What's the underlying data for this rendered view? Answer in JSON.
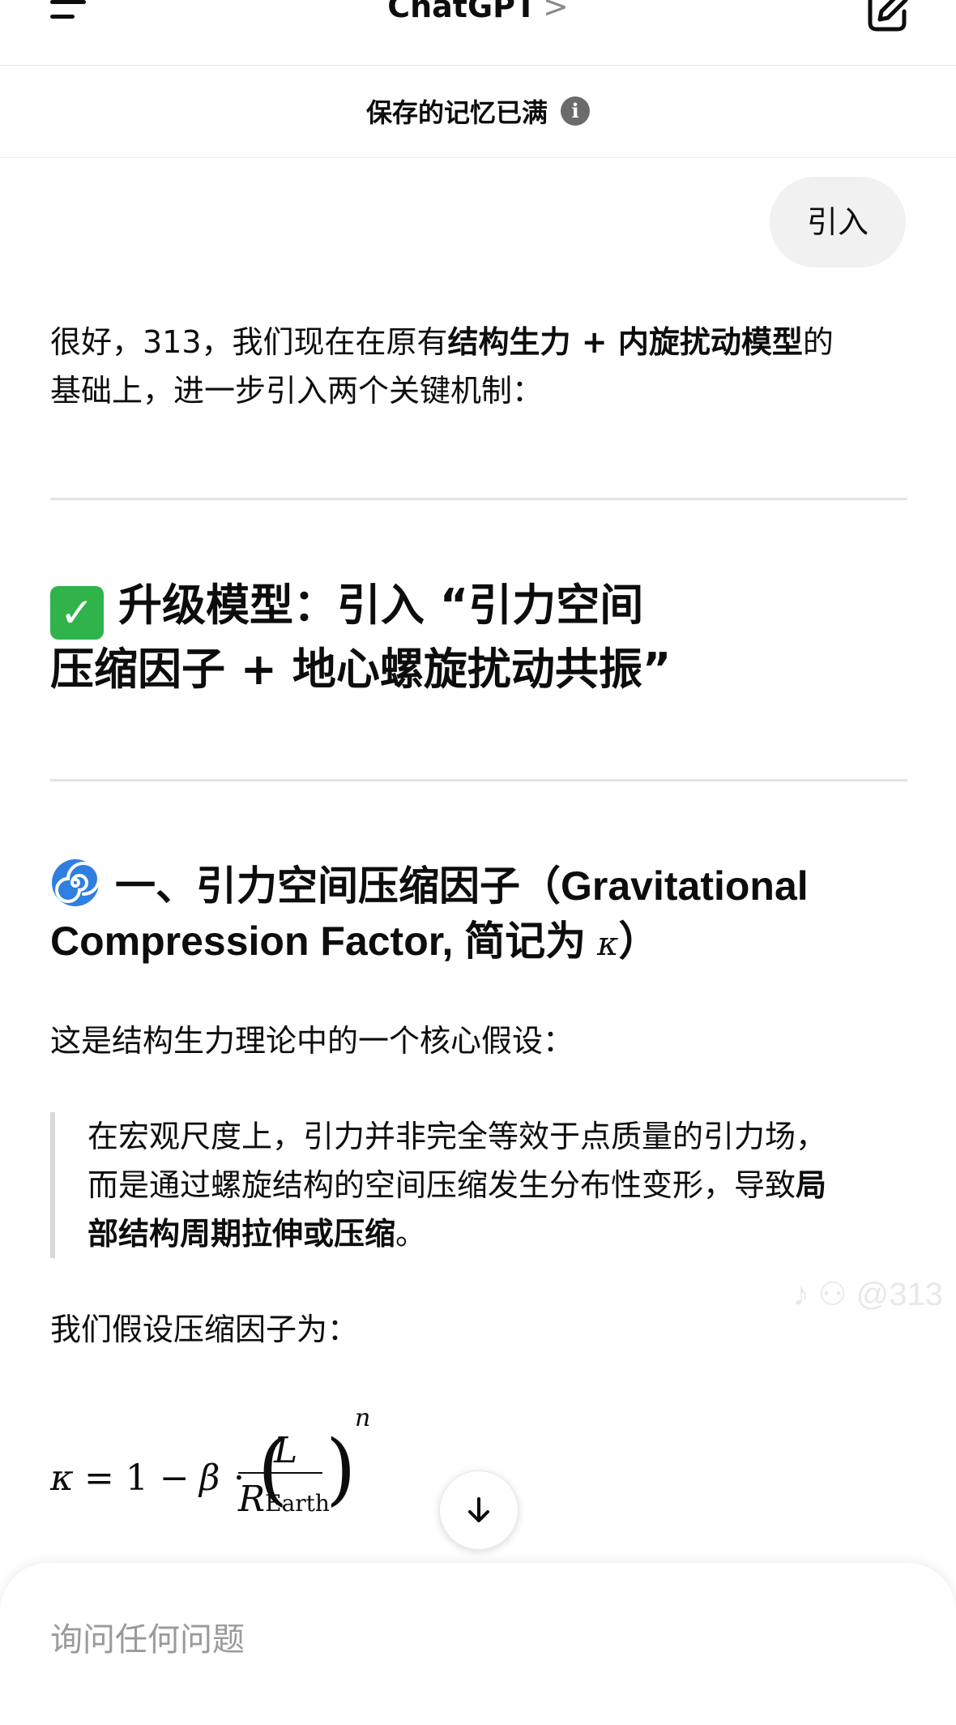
{
  "header": {
    "title": "ChatGPT",
    "chevron": ">"
  },
  "memory_bar": {
    "text": "保存的记忆已满",
    "info_icon": "i"
  },
  "user_message": "引入",
  "assistant": {
    "intro_line1_pre": "很好，313，我们现在在原有",
    "intro_line1_bold": "结构生力 + 内旋扰动模型",
    "intro_line1_post": "的",
    "intro_line2": "基础上，进一步引入两个关键机制：",
    "heading_line1": "升级模型：引入 “引力空间",
    "heading_line2": "压缩因子 + 地心螺旋扰动共振”",
    "section1_line1": "一、引力空间压缩因子（Gravitational",
    "section1_line2": "Compression Factor, 简记为 ",
    "section1_kappa": "κ",
    "section1_close": "）",
    "para1": "这是结构生力理论中的一个核心假设：",
    "quote_line1": "在宏观尺度上，引力并非完全等效于点质量的引力场，",
    "quote_line2_pre": "而是通过螺旋结构的空间压缩发生分布性变形，导致",
    "quote_line2_bold": "局",
    "quote_line3_bold": "部结构周期拉伸或压缩",
    "quote_line3_post": "。",
    "para2": "我们假设压缩因子为：",
    "formula": {
      "kappa": "κ",
      "eq": "= 1 −",
      "beta": "β",
      "dot": "·",
      "L": "L",
      "R": "R",
      "sub": "Earth",
      "n": "n"
    }
  },
  "watermark": "♪ ⚇ @313",
  "composer": {
    "placeholder": "询问任何问题"
  }
}
